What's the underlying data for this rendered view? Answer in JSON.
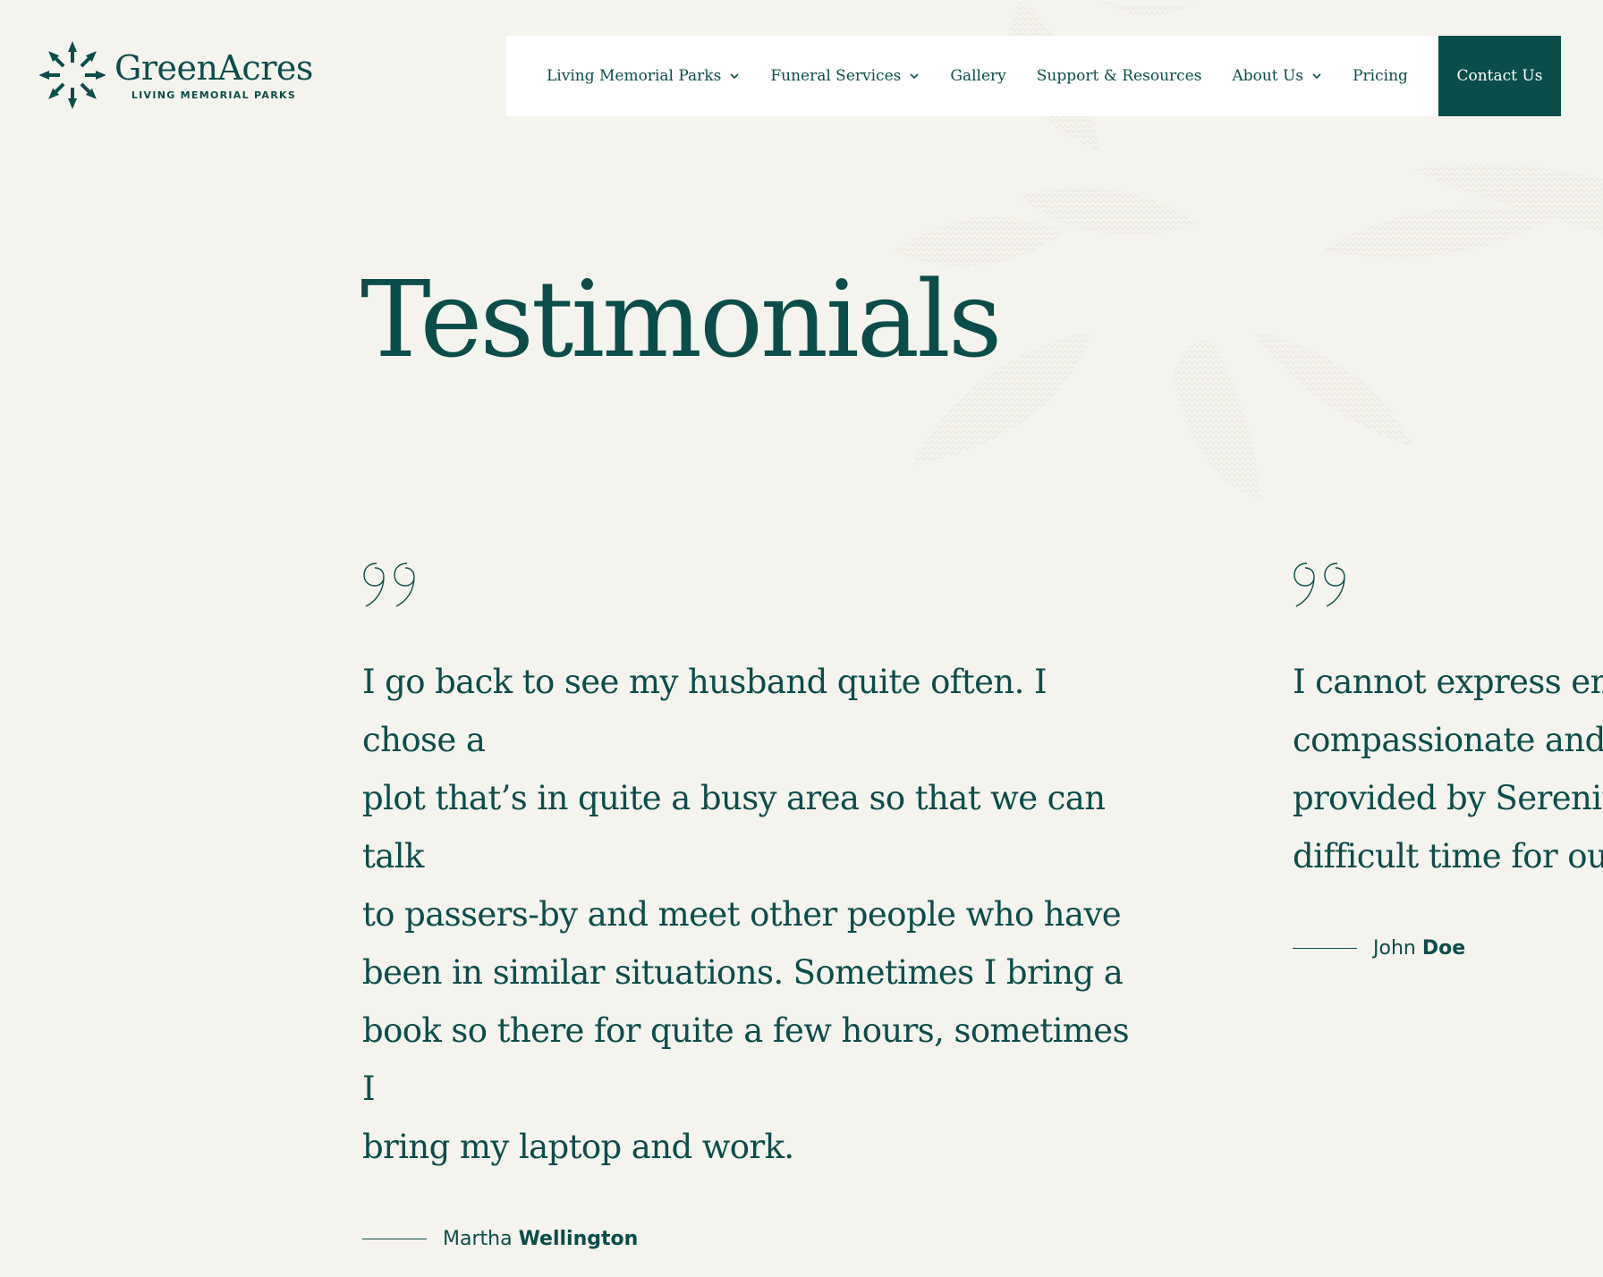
{
  "brand": {
    "name": "GreenAcres",
    "tagline": "LIVING MEMORIAL PARKS",
    "color": "#0b4d4a"
  },
  "nav": {
    "items": [
      {
        "label": "Living Memorial Parks",
        "has_dropdown": true
      },
      {
        "label": "Funeral Services",
        "has_dropdown": true
      },
      {
        "label": "Gallery",
        "has_dropdown": false
      },
      {
        "label": "Support & Resources",
        "has_dropdown": false
      },
      {
        "label": "About Us",
        "has_dropdown": true
      },
      {
        "label": "Pricing",
        "has_dropdown": false
      }
    ],
    "contact_label": "Contact Us"
  },
  "page": {
    "title": "Testimonials"
  },
  "testimonials": [
    {
      "lines": [
        "I go back to see my husband quite often. I chose a",
        "plot that’s in quite a busy area so that we can talk",
        "to passers-by and meet other people who have",
        "been in similar situations. Sometimes I bring a",
        "book so there for quite a few hours, sometimes I",
        "bring my laptop and work."
      ],
      "author_first": "Martha",
      "author_last": "Wellington"
    },
    {
      "lines": [
        "I cannot express eno",
        "compassionate and p",
        "provided by Serenity",
        "difficult time for our"
      ],
      "author_first": "John",
      "author_last": "Doe"
    }
  ],
  "colors": {
    "background": "#f4f3ee",
    "accent": "#0b4d4a",
    "nav_background": "#ffffff"
  }
}
